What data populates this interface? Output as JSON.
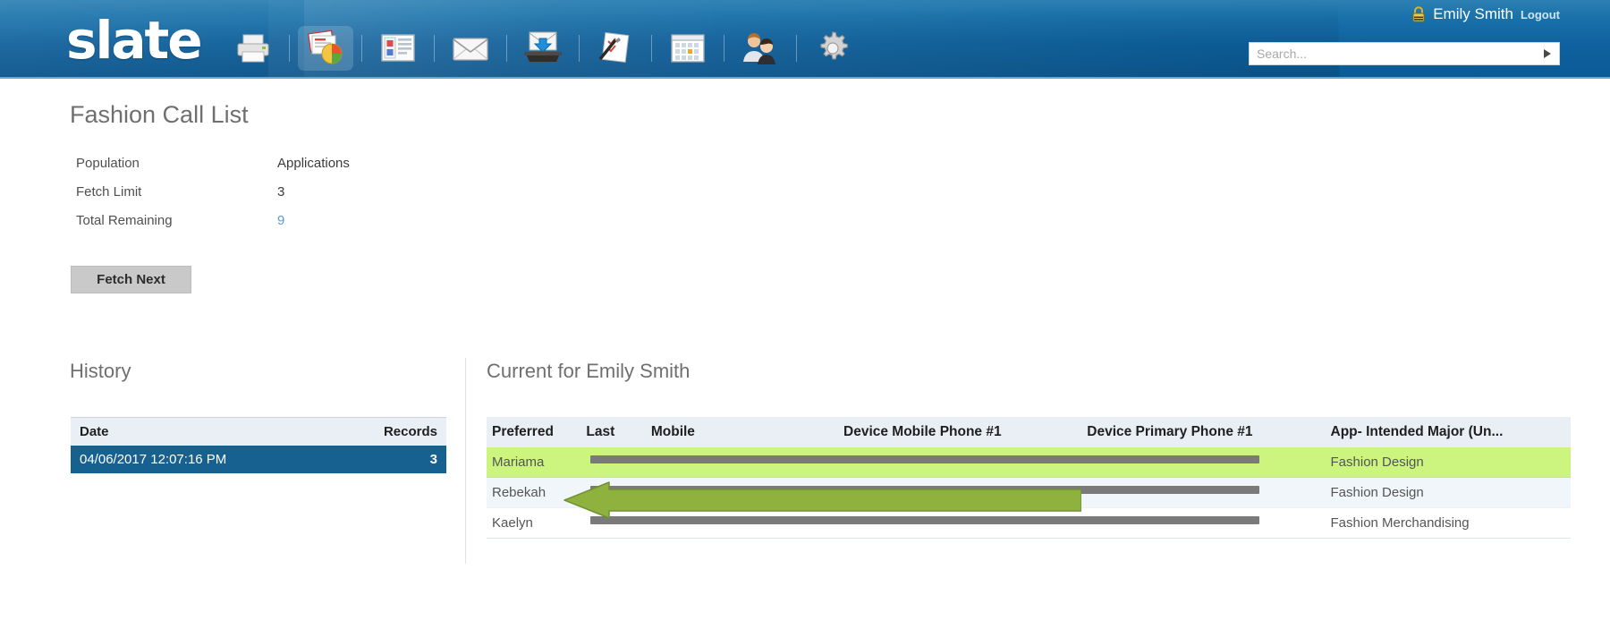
{
  "header": {
    "logo": "slate",
    "user": {
      "name": "Emily Smith",
      "logout": "Logout",
      "lock_icon": "lock-icon"
    },
    "search": {
      "placeholder": "Search...",
      "value": "",
      "go_icon": "triangle-right-icon"
    },
    "nav": [
      {
        "name": "printer-icon",
        "label": "Print",
        "active": false
      },
      {
        "name": "reports-icon",
        "label": "Reports",
        "active": true
      },
      {
        "name": "records-icon",
        "label": "Records",
        "active": false
      },
      {
        "name": "mail-icon",
        "label": "Mail",
        "active": false
      },
      {
        "name": "inbox-download-icon",
        "label": "Inbox",
        "active": false
      },
      {
        "name": "checklist-pen-icon",
        "label": "Forms",
        "active": false
      },
      {
        "name": "calendar-icon",
        "label": "Calendar",
        "active": false
      },
      {
        "name": "people-icon",
        "label": "People",
        "active": false
      },
      {
        "name": "gear-icon",
        "label": "Settings",
        "active": false
      }
    ]
  },
  "page": {
    "title": "Fashion Call List",
    "meta": [
      {
        "label": "Population",
        "value": "Applications",
        "is_link": false
      },
      {
        "label": "Fetch Limit",
        "value": "3",
        "is_link": false
      },
      {
        "label": "Total Remaining",
        "value": "9",
        "is_link": true
      }
    ],
    "fetch_button": "Fetch Next"
  },
  "history": {
    "title": "History",
    "columns": [
      "Date",
      "Records"
    ],
    "rows": [
      {
        "date": "04/06/2017 12:07:16 PM",
        "records": "3",
        "selected": true
      }
    ]
  },
  "current": {
    "title": "Current for Emily Smith",
    "columns": [
      "Preferred",
      "Last",
      "Mobile",
      "Device Mobile Phone #1",
      "Device Primary Phone #1",
      "App- Intended Major (Un..."
    ],
    "rows": [
      {
        "preferred": "Mariama",
        "last": "",
        "mobile": "",
        "device_mobile": "",
        "device_primary": "",
        "major": "Fashion Design",
        "highlight": "green"
      },
      {
        "preferred": "Rebekah",
        "last": "",
        "mobile": "",
        "device_mobile": "",
        "device_primary": "",
        "major": "Fashion Design",
        "highlight": "alt"
      },
      {
        "preferred": "Kaelyn",
        "last": "",
        "mobile": "",
        "device_mobile": "",
        "device_primary": "",
        "major": "Fashion Merchandising",
        "highlight": "plain"
      }
    ]
  },
  "annotation": {
    "type": "arrow-left",
    "color": "#8fb23f",
    "target_row": "Rebekah"
  },
  "colors": {
    "header_blue": "#0e619e",
    "highlight_green": "#ccf57f",
    "arrow_green": "#8fb23f",
    "selected_row_blue": "#16618f",
    "link_blue": "#5b9bd5",
    "redaction_gray": "#7a7a7a"
  }
}
